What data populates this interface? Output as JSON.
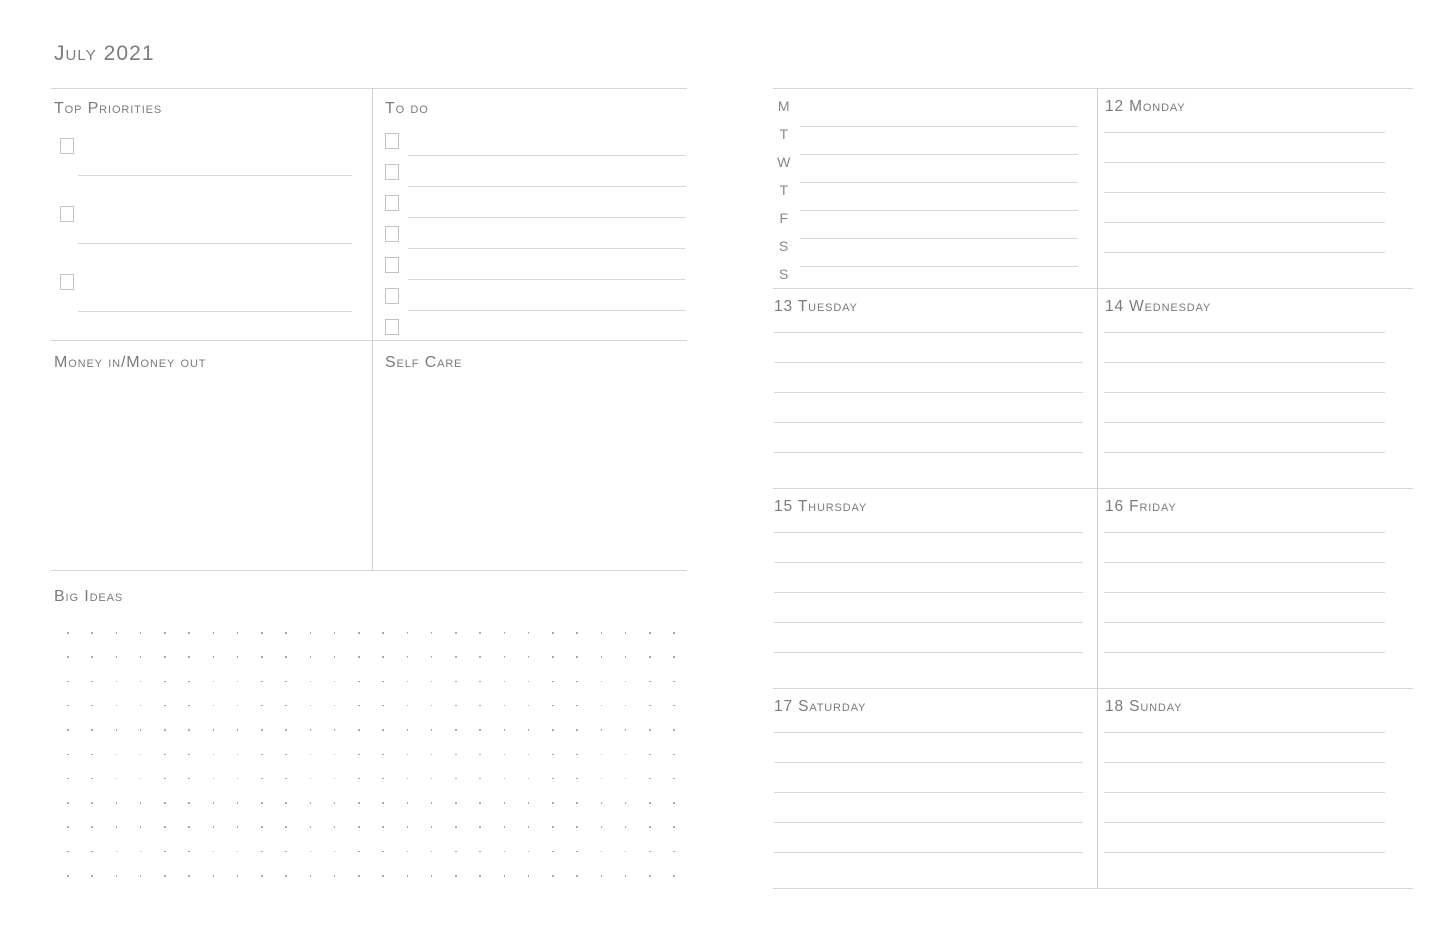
{
  "document": {
    "type": "weekly-planner-spread",
    "month_title": "July 2021"
  },
  "left_page": {
    "sections": {
      "top_priorities": {
        "heading": "Top Priorities",
        "checkbox_count": 3,
        "line_count": 3
      },
      "to_do": {
        "heading": "To do",
        "checkbox_count": 7,
        "line_count": 6
      },
      "money": {
        "heading": "Money in/Money out"
      },
      "self_care": {
        "heading": "Self Care"
      },
      "big_ideas": {
        "heading": "Big Ideas",
        "dot_columns": 26,
        "dot_rows": 11
      }
    }
  },
  "right_page": {
    "week_overview": {
      "day_letters": [
        "M",
        "T",
        "W",
        "T",
        "F",
        "S",
        "S"
      ],
      "line_count": 6
    },
    "days": [
      {
        "number": "12",
        "name": "Monday",
        "lines": 5
      },
      {
        "number": "13",
        "name": "Tuesday",
        "lines": 5
      },
      {
        "number": "14",
        "name": "Wednesday",
        "lines": 5
      },
      {
        "number": "15",
        "name": "Thursday",
        "lines": 5
      },
      {
        "number": "16",
        "name": "Friday",
        "lines": 5
      },
      {
        "number": "17",
        "name": "Saturday",
        "lines": 5
      },
      {
        "number": "18",
        "name": "Sunday",
        "lines": 5
      }
    ]
  },
  "colors": {
    "page_background": "#ffffff",
    "text": "#7b7b7b",
    "rule": "#d6d6d6",
    "writing_line": "#d9d9d9",
    "checkbox_border": "#c4c4c4",
    "dot": "#9b9b9b"
  }
}
